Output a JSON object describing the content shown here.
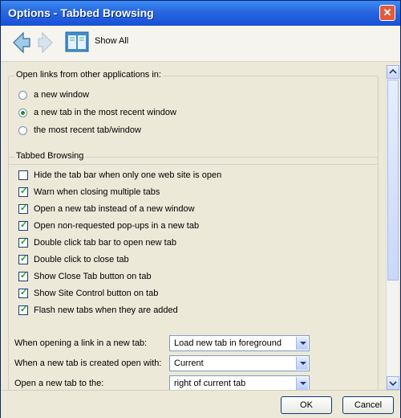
{
  "window": {
    "title": "Options - Tabbed Browsing"
  },
  "toolbar": {
    "show_all_label": "Show All"
  },
  "open_links": {
    "legend": "Open links from other applications in:",
    "options": [
      {
        "label": "a new window",
        "selected": false
      },
      {
        "label": "a new tab in the most recent window",
        "selected": true
      },
      {
        "label": "the most recent tab/window",
        "selected": false
      }
    ]
  },
  "tabbed_browsing": {
    "legend": "Tabbed Browsing",
    "checkboxes": [
      {
        "label": "Hide the tab bar when only one web site is open",
        "checked": false
      },
      {
        "label": "Warn when closing multiple tabs",
        "checked": true
      },
      {
        "label": "Open a new tab instead of a new window",
        "checked": true
      },
      {
        "label": "Open non-requested pop-ups in a new tab",
        "checked": true
      },
      {
        "label": "Double click tab bar to open new tab",
        "checked": true
      },
      {
        "label": "Double click to close tab",
        "checked": true
      },
      {
        "label": "Show Close Tab button on tab",
        "checked": true
      },
      {
        "label": "Show Site Control button on tab",
        "checked": true
      },
      {
        "label": "Flash new tabs when they are added",
        "checked": true
      }
    ],
    "selects": [
      {
        "label": "When opening a link in a new tab:",
        "value": "Load new tab in foreground"
      },
      {
        "label": "When a new tab is created open with:",
        "value": "Current"
      },
      {
        "label": "Open a new tab to the:",
        "value": "right of current tab"
      }
    ]
  },
  "buttons": {
    "ok": "OK",
    "cancel": "Cancel"
  },
  "colors": {
    "title_bar": "#2a6ae0",
    "check_mark": "#1e9e2f",
    "radio_dot": "#1a8f2f"
  }
}
